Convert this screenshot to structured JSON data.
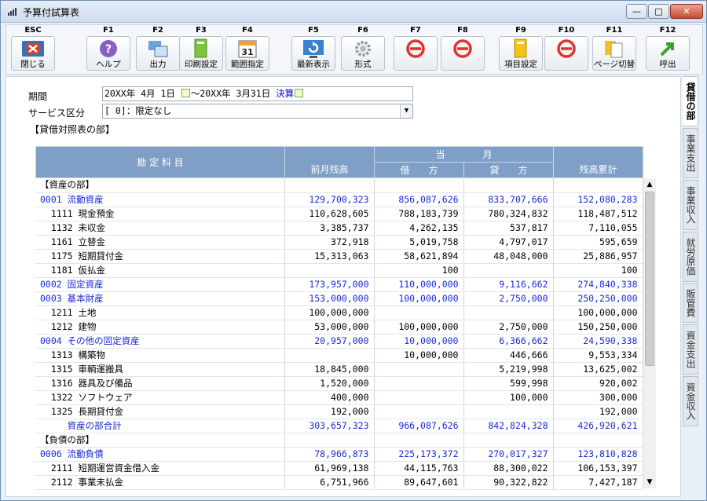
{
  "window": {
    "title": "予算付試算表",
    "min": "—",
    "max": "□",
    "close": "✕"
  },
  "toolbar": [
    {
      "key": "ESC",
      "label": "閉じる",
      "icon": "close-window-icon"
    },
    {
      "key": "F1",
      "label": "ヘルプ",
      "icon": "help-icon"
    },
    {
      "key": "F2",
      "label": "出力",
      "icon": "output-icon"
    },
    {
      "key": "F3",
      "label": "印刷設定",
      "icon": "print-settings-icon"
    },
    {
      "key": "F4",
      "label": "範囲指定",
      "icon": "calendar-icon",
      "cal_day": "31"
    },
    {
      "key": "F5",
      "label": "最新表示",
      "icon": "refresh-icon"
    },
    {
      "key": "F6",
      "label": "形式",
      "icon": "gear-icon"
    },
    {
      "key": "F7",
      "label": "",
      "icon": "disabled-icon"
    },
    {
      "key": "F8",
      "label": "",
      "icon": "disabled-icon"
    },
    {
      "key": "F9",
      "label": "項目設定",
      "icon": "item-settings-icon"
    },
    {
      "key": "F10",
      "label": "",
      "icon": "disabled-icon"
    },
    {
      "key": "F11",
      "label": "ページ切替",
      "icon": "page-switch-icon"
    },
    {
      "key": "F12",
      "label": "呼出",
      "icon": "recall-arrow-icon"
    }
  ],
  "filters": {
    "period_label": "期間",
    "period_from": "20XX年 4月 1日",
    "period_sep": "～",
    "period_to": "20XX年 3月31日",
    "period_kessan": "決算",
    "service_label": "サービス区分",
    "service_value": "[      0]：限定なし"
  },
  "section_title": "【貸借対照表の部】",
  "table": {
    "headers": {
      "account": "勘 定 科 目",
      "prev": "前月残高",
      "month": "当　　　　月",
      "debit": "借　　方",
      "credit": "貸　　方",
      "cumulative": "残高累計"
    },
    "rows": [
      {
        "account": "【資産の部】",
        "prev": "",
        "debit": "",
        "credit": "",
        "cum": "",
        "blue": false
      },
      {
        "account": "0001 流動資産",
        "prev": "129,700,323",
        "debit": "856,087,626",
        "credit": "833,707,666",
        "cum": "152,080,283",
        "blue": true
      },
      {
        "account": "  1111 現金預金",
        "prev": "110,628,605",
        "debit": "788,183,739",
        "credit": "780,324,832",
        "cum": "118,487,512",
        "blue": false
      },
      {
        "account": "  1132 未収金",
        "prev": "3,385,737",
        "debit": "4,262,135",
        "credit": "537,817",
        "cum": "7,110,055",
        "blue": false
      },
      {
        "account": "  1161 立替金",
        "prev": "372,918",
        "debit": "5,019,758",
        "credit": "4,797,017",
        "cum": "595,659",
        "blue": false
      },
      {
        "account": "  1175 短期貸付金",
        "prev": "15,313,063",
        "debit": "58,621,894",
        "credit": "48,048,000",
        "cum": "25,886,957",
        "blue": false
      },
      {
        "account": "  1181 仮払金",
        "prev": "",
        "debit": "100",
        "credit": "",
        "cum": "100",
        "blue": false
      },
      {
        "account": "0002 固定資産",
        "prev": "173,957,000",
        "debit": "110,000,000",
        "credit": "9,116,662",
        "cum": "274,840,338",
        "blue": true
      },
      {
        "account": "0003 基本財産",
        "prev": "153,000,000",
        "debit": "100,000,000",
        "credit": "2,750,000",
        "cum": "250,250,000",
        "blue": true
      },
      {
        "account": "  1211 土地",
        "prev": "100,000,000",
        "debit": "",
        "credit": "",
        "cum": "100,000,000",
        "blue": false
      },
      {
        "account": "  1212 建物",
        "prev": "53,000,000",
        "debit": "100,000,000",
        "credit": "2,750,000",
        "cum": "150,250,000",
        "blue": false
      },
      {
        "account": "0004 その他の固定資産",
        "prev": "20,957,000",
        "debit": "10,000,000",
        "credit": "6,366,662",
        "cum": "24,590,338",
        "blue": true
      },
      {
        "account": "  1313 構築物",
        "prev": "",
        "debit": "10,000,000",
        "credit": "446,666",
        "cum": "9,553,334",
        "blue": false
      },
      {
        "account": "  1315 車輌運搬具",
        "prev": "18,845,000",
        "debit": "",
        "credit": "5,219,998",
        "cum": "13,625,002",
        "blue": false
      },
      {
        "account": "  1316 器具及び備品",
        "prev": "1,520,000",
        "debit": "",
        "credit": "599,998",
        "cum": "920,002",
        "blue": false
      },
      {
        "account": "  1322 ソフトウェア",
        "prev": "400,000",
        "debit": "",
        "credit": "100,000",
        "cum": "300,000",
        "blue": false
      },
      {
        "account": "  1325 長期貸付金",
        "prev": "192,000",
        "debit": "",
        "credit": "",
        "cum": "192,000",
        "blue": false
      },
      {
        "account": "     資産の部合計",
        "prev": "303,657,323",
        "debit": "966,087,626",
        "credit": "842,824,328",
        "cum": "426,920,621",
        "blue": true
      },
      {
        "account": "【負債の部】",
        "prev": "",
        "debit": "",
        "credit": "",
        "cum": "",
        "blue": false
      },
      {
        "account": "0006 流動負債",
        "prev": "78,966,873",
        "debit": "225,173,372",
        "credit": "270,017,327",
        "cum": "123,810,828",
        "blue": true
      },
      {
        "account": "  2111 短期運営資金借入金",
        "prev": "61,969,138",
        "debit": "44,115,763",
        "credit": "88,300,022",
        "cum": "106,153,397",
        "blue": false
      },
      {
        "account": "  2112 事業未払金",
        "prev": "6,751,966",
        "debit": "89,647,601",
        "credit": "90,322,822",
        "cum": "7,427,187",
        "blue": false
      }
    ]
  },
  "side_tabs": [
    "貸借の部",
    "事業支出",
    "事業収入",
    "就労原価",
    "販管費",
    "資金支出",
    "資金収入"
  ],
  "colors": {
    "header_bg": "#7f9fc6",
    "blue_text": "#1a2ad6",
    "disabled_red": "#e0332b"
  }
}
